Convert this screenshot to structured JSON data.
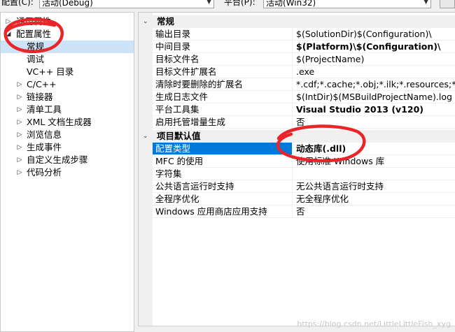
{
  "topbar": {
    "config_label": "配置(C):",
    "config_value": "活动(Debug)",
    "platform_label": "平台(P):",
    "platform_value": "活动(Win32)"
  },
  "tree": {
    "items": [
      {
        "label": "通用属性",
        "expander": "▷"
      },
      {
        "label": "配置属性",
        "expander": "◢"
      },
      {
        "label": "常规",
        "expander": ""
      },
      {
        "label": "调试",
        "expander": ""
      },
      {
        "label": "VC++ 目录",
        "expander": ""
      },
      {
        "label": "C/C++",
        "expander": "▷"
      },
      {
        "label": "链接器",
        "expander": "▷"
      },
      {
        "label": "清单工具",
        "expander": "▷"
      },
      {
        "label": "XML 文档生成器",
        "expander": "▷"
      },
      {
        "label": "浏览信息",
        "expander": "▷"
      },
      {
        "label": "生成事件",
        "expander": "▷"
      },
      {
        "label": "自定义生成步骤",
        "expander": "▷"
      },
      {
        "label": "代码分析",
        "expander": "▷"
      }
    ]
  },
  "grid": {
    "general": {
      "title": "常规",
      "expander": "⌄",
      "rows": [
        {
          "name": "输出目录",
          "value": "$(SolutionDir)$(Configuration)\\"
        },
        {
          "name": "中间目录",
          "value": "$(Platform)\\$(Configuration)\\"
        },
        {
          "name": "目标文件名",
          "value": "$(ProjectName)"
        },
        {
          "name": "目标文件扩展名",
          "value": ".exe"
        },
        {
          "name": "清除时要删除的扩展名",
          "value": "*.cdf;*.cache;*.obj;*.ilk;*.resources;*.tlb;"
        },
        {
          "name": "生成日志文件",
          "value": "$(IntDir)$(MSBuildProjectName).log"
        },
        {
          "name": "平台工具集",
          "value": "Visual Studio 2013 (v120)"
        },
        {
          "name": "启用托管增量生成",
          "value": "否"
        }
      ]
    },
    "defaults": {
      "title": "项目默认值",
      "expander": "⌄",
      "rows": [
        {
          "name": "配置类型",
          "value": "动态库(.dll)"
        },
        {
          "name": "MFC 的使用",
          "value": "使用标准 Windows 库"
        },
        {
          "name": "字符集",
          "value": ""
        },
        {
          "name": "公共语言运行时支持",
          "value": "无公共语言运行时支持"
        },
        {
          "name": "全程序优化",
          "value": "无全程序优化"
        },
        {
          "name": "Windows 应用商店应用支持",
          "value": "否"
        }
      ]
    }
  },
  "watermark": "https://blog.csdn.net/LittleLittleFish_xyg",
  "colors": {
    "selection": "#0078d7",
    "tree_selection": "#cde3f7",
    "annotation": "#e8262a"
  }
}
